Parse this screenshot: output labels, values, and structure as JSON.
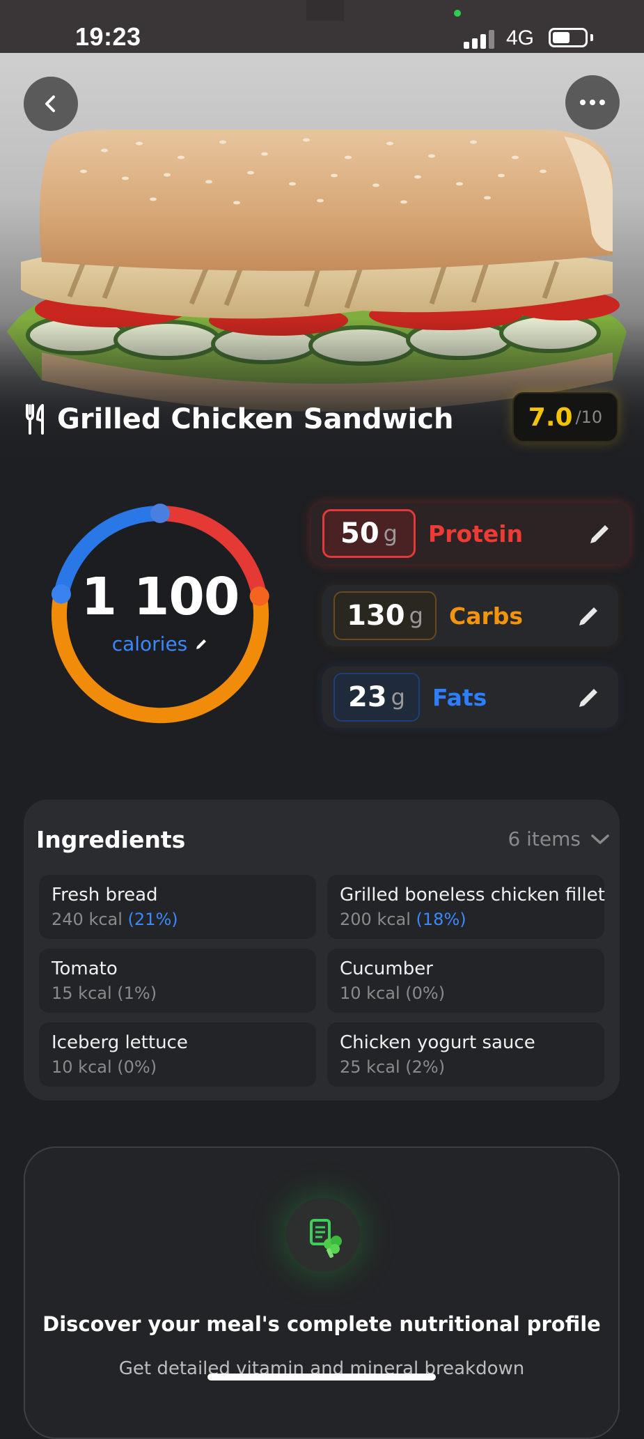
{
  "status_bar": {
    "time": "19:23",
    "network": "4G",
    "battery_level": 0.55
  },
  "hero": {
    "image_name": "grilled-chicken-sandwich-photo",
    "back_icon": "chevron-left-icon",
    "more_icon": "more-dots-icon"
  },
  "meal": {
    "title": "Grilled Chicken Sandwich",
    "icon": "fork-knife-icon",
    "score": "7.0",
    "score_max": "/10"
  },
  "calories": {
    "value": "1 100",
    "label": "calories",
    "ring_colors": {
      "protein": "#e53935",
      "carbs": "#f08c0a",
      "fats": "#2a78e8"
    }
  },
  "macros": {
    "protein": {
      "value": "50",
      "unit": "g",
      "label": "Protein",
      "color": "#ef3b35"
    },
    "carbs": {
      "value": "130",
      "unit": "g",
      "label": "Carbs",
      "color": "#f3940f"
    },
    "fats": {
      "value": "23",
      "unit": "g",
      "label": "Fats",
      "color": "#2d7fff"
    }
  },
  "ingredients": {
    "title": "Ingredients",
    "count": "6 items",
    "items": [
      {
        "name": "Fresh bread",
        "kcal": "240 kcal",
        "pct": "(21%)",
        "pct_highlight": true
      },
      {
        "name": "Grilled boneless chicken fillet",
        "kcal": "200 kcal",
        "pct": "(18%)",
        "pct_highlight": true
      },
      {
        "name": "Tomato",
        "kcal": "15 kcal",
        "pct": "(1%)",
        "pct_highlight": false
      },
      {
        "name": "Cucumber",
        "kcal": "10 kcal",
        "pct": "(0%)",
        "pct_highlight": false
      },
      {
        "name": "Iceberg lettuce",
        "kcal": "10 kcal",
        "pct": "(0%)",
        "pct_highlight": false
      },
      {
        "name": "Chicken yogurt sauce",
        "kcal": "25 kcal",
        "pct": "(2%)",
        "pct_highlight": false
      }
    ]
  },
  "profile_card": {
    "icon": "nutrition-report-broccoli-icon",
    "title": "Discover your meal's complete nutritional profile",
    "subtitle": "Get detailed vitamin and mineral breakdown"
  }
}
